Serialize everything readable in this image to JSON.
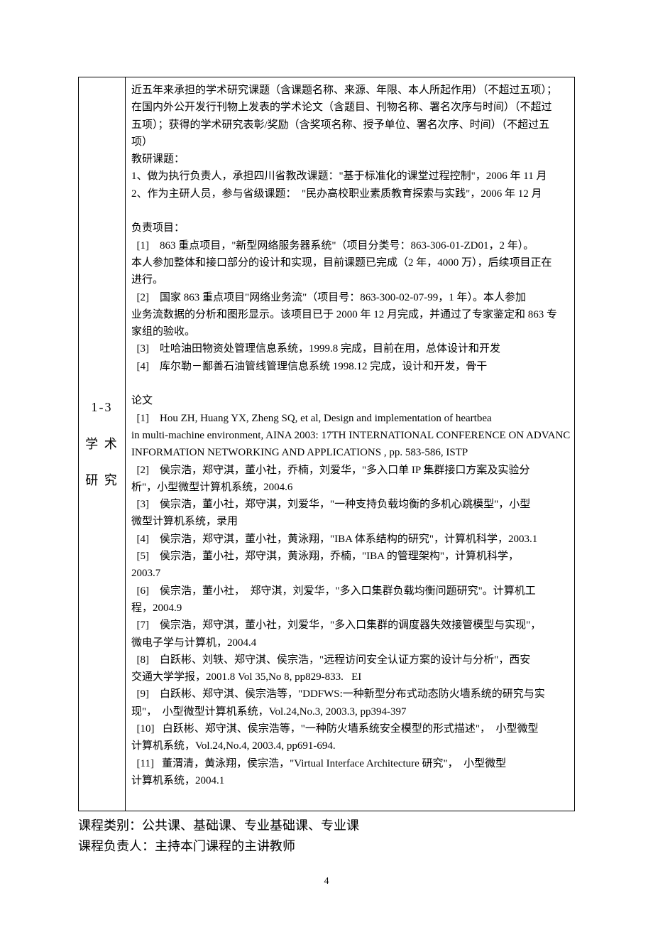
{
  "side": {
    "num": "1-3",
    "line1": "学 术",
    "line2": "研 究"
  },
  "content": {
    "intro1": "近五年来承担的学术研究课题（含课题名称、来源、年限、本人所起作用）（不超过五项）；",
    "intro2": "在国内外公开发行刊物上发表的学术论文（含题目、刊物名称、署名次序与时间）（不超过",
    "intro3": "五项）；获得的学术研究表彰/奖励（含奖项名称、授予单位、署名次序、时间）（不超过五",
    "intro4": "项）",
    "jy_title": "教研课题：",
    "jy_1": "1、做为执行负责人，承担四川省教改课题：\"基于标准化的课堂过程控制\"，2006 年 11 月",
    "jy_2": "2、作为主研人员，参与省级课题：  \"民办高校职业素质教育探索与实践\"，2006 年 12 月",
    "proj_title": "负责项目：",
    "proj_1a": "  [1]    863 重点项目，\"新型网络服务器系统\"（项目分类号：863-306-01-ZD01，2 年）。",
    "proj_1b": "本人参加整体和接口部分的设计和实现，目前课题已完成（2 年，4000 万），后续项目正在",
    "proj_1c": "进行。",
    "proj_2a": "  [2]    国家 863 重点项目\"网络业务流\"（项目号：863-300-02-07-99，1 年）。本人参加",
    "proj_2b": "业务流数据的分析和图形显示。该项目已于 2000 年 12 月完成，并通过了专家鉴定和 863 专",
    "proj_2c": "家组的验收。",
    "proj_3": "  [3]    吐哈油田物资处管理信息系统，1999.8 完成，目前在用，总体设计和开发",
    "proj_4": "  [4]    库尔勒－鄯善石油管线管理信息系统 1998.12 完成，设计和开发，骨干",
    "paper_title": "论文",
    "paper_1a": "  [1]    Hou ZH, Huang YX, Zheng SQ, et al, Design and implementation of heartbea",
    "paper_1b": "in multi-machine environment, AINA 2003: 17TH INTERNATIONAL CONFERENCE ON ADVANC",
    "paper_1c": "INFORMATION NETWORKING AND APPLICATIONS , pp. 583-586, ISTP",
    "paper_2a": "  [2]    侯宗浩，郑守淇，董小社，乔楠，刘爱华，\"多入口单 IP 集群接口方案及实验分",
    "paper_2b": "析\"，小型微型计算机系统，2004.6",
    "paper_3a": "  [3]    侯宗浩，董小社，郑守淇，刘爱华，\"一种支持负载均衡的多机心跳模型\"，小型",
    "paper_3b": "微型计算机系统，录用",
    "paper_4": "  [4]    侯宗浩，郑守淇，董小社，黄泳翔，\"IBA 体系结构的研究\"，计算机科学，2003.1",
    "paper_5a": "  [5]    侯宗浩，董小社，郑守淇，黄泳翔，乔楠，\"IBA 的管理架构\"，计算机科学，",
    "paper_5b": "2003.7",
    "paper_6a": "  [6]    侯宗浩，董小社，  郑守淇，刘爱华，\"多入口集群负载均衡问题研究\"。计算机工",
    "paper_6b": "程，2004.9",
    "paper_7a": "  [7]    侯宗浩，郑守淇，董小社，刘爱华，\"多入口集群的调度器失效接管模型与实现\"，",
    "paper_7b": "微电子学与计算机，2004.4",
    "paper_8a": "  [8]    白跃彬、刘轶、郑守淇、侯宗浩，\"远程访问安全认证方案的设计与分析\"，西安",
    "paper_8b": "交通大学学报，2001.8 Vol 35,No 8, pp829-833.   EI",
    "paper_9a": "  [9]    白跃彬、郑守淇、侯宗浩等，\"DDFWS:一种新型分布式动态防火墙系统的研究与实",
    "paper_9b": "现\"，  小型微型计算机系统，Vol.24,No.3, 2003.3, pp394-397",
    "paper_10a": "  [10]   白跃彬、郑守淇、侯宗浩等，\"一种防火墙系统安全模型的形式描述\"，  小型微型",
    "paper_10b": "计算机系统，Vol.24,No.4, 2003.4, pp691-694.",
    "paper_11a": "  [11]   董渭清，黄泳翔，侯宗浩，\"Virtual Interface Architecture 研究\"，  小型微型",
    "paper_11b": "计算机系统，2004.1"
  },
  "footnotes": {
    "f1": "课程类别：公共课、基础课、专业基础课、专业课",
    "f2": "课程负责人：主持本门课程的主讲教师"
  },
  "page_number": "4"
}
